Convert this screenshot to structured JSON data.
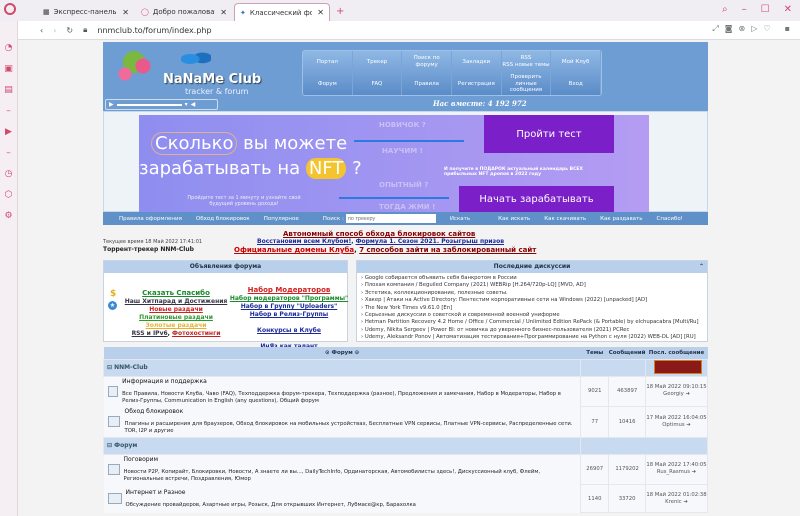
{
  "browser": {
    "tabs": [
      {
        "label": "Экспресс-панель"
      },
      {
        "label": "Добро пожаловать в Opera"
      },
      {
        "label": "Классический форум-трекер"
      }
    ],
    "url": "nnmclub.to/forum/index.php"
  },
  "header": {
    "logo": "NaNaMe Club",
    "logo_sub": "tracker & forum",
    "together": "Нас вместе: 4 192 972",
    "menu": [
      "Портал",
      "Трекер",
      "Поиск по форуму",
      "Закладки",
      "RSS\nRSS новые темы",
      "Мой Клуб",
      "Форум",
      "FAQ",
      "Правила",
      "Регистрация",
      "Проверить личные сообщения",
      "Вход"
    ]
  },
  "banner": {
    "line1a": "Сколько",
    "line1b": " вы можете",
    "line2a": "зарабатывать на ",
    "nft": "NFT",
    "line2b": " ?",
    "sub": "Пройдите тест за 1 минуту и узнайте свой будущий уровень дохода!",
    "q1": "НОВИЧОК ?",
    "q2": "НАУЧИМ !",
    "q3": "ОПЫТНЫЙ ?",
    "q4": "ТОГДА ЖМИ !",
    "btn1": "Пройти тест",
    "btn2": "Начать зарабатывать",
    "gift": "И получите в ПОДАРОК актуальный календарь ВСЕХ прибыльных NFT дропов в 2022 году"
  },
  "nav": {
    "items": [
      "Правила оформления",
      "Обход блокировок",
      "Популярное"
    ],
    "search_label": "Поиск :",
    "search_placeholder": "по трекеру",
    "search_btn": "Искать",
    "links": [
      "Как искать",
      "Как скачивать",
      "Как раздавать",
      "Спасибо!"
    ]
  },
  "notice": {
    "n1": "Автономный способ обхода блокировок сайтов",
    "n2a": "Восстановим всем Клубом!",
    "n2b": "Формула 1. Сезон 2021. Розыгрыш призов",
    "n3a": "Официальные домены Клуба",
    "n3b": "7 способов зайти на заблокированный сайт",
    "time": "Текущее время 18 Май 2022 17:41:01",
    "tracker": "Торрент-трекер NNM-Club"
  },
  "announce": {
    "title": "Объявления форума",
    "left": [
      "Сказать Спасибо",
      "Наш Хитпарад и Достижения",
      "Новые раздачи",
      "Платиновые раздачи",
      "Золотые раздачи",
      "RSS и IPv6",
      "Фотохостинги"
    ],
    "right": [
      "Набор Модераторов",
      "Набор модераторов \"Программы\"",
      "Набор в Группу \"Uploaders\"",
      "Набор в Релиз-Группы",
      "Конкурсы в Клубе",
      "ИнЯз как талант"
    ]
  },
  "discussions": {
    "title": "Последние дискуссии",
    "items": [
      "Google собирается объявить себя банкротом в России",
      "Плохая компания / Beguiled Company (2021) WEBRip [H.264/720p-LQ] [MVO, AD]",
      "Эстетика, коллекционирование, полезные советы.",
      "Хакер | Атаки на Active Directory: Пентестим корпоративные сети на Windows (2022) [unpacked] [AD]",
      "The New York Times v9.61.0 [En]",
      "Серьезные дискуссии о советской и современной военной униформе",
      "Hetman Partition Recovery 4.2 Home / Office / Commercial / Unlimited Edition RePack (& Portable) by elchupacabra [Multi/Ru]",
      "Udemy, Nikita Sergeev | Power BI: от новичка до уверенного бизнес-пользователя (2021) PCRec",
      "Udemy, Aleksandr Ponov | Автоматизация тестирования+Программирование на Python с нуля (2022) WEB-DL [AD] [RU]"
    ]
  },
  "forum": {
    "headers": [
      "Форум",
      "Темы",
      "Сообщений",
      "Посл. сообщение"
    ],
    "categories": [
      {
        "name": "NNM-Club",
        "forums": [
          {
            "title": "Информация и поддержка",
            "subs": "Все Правила, Новости Клуба, Чаво (FAQ), Техподдержка форум-трекера, Техподдержка (разное), Предложения и замечания, Набор в Модераторы, Набор в Релиз-Группы, Communication in English (any questions), Общий форум",
            "topics": "9021",
            "posts": "463897",
            "last_date": "18 Май 2022 09:10:15",
            "last_user": "Georgiy"
          },
          {
            "title": "Обход блокировок",
            "subs": "Плагины и расширения для браузеров, Обход блокировок на мобильных устройствах, Бесплатные VPN сервисы, Платные VPN-сервисы, Распределенные сети. TOR, I2P и другие",
            "topics": "77",
            "posts": "10416",
            "last_date": "17 Май 2022 16:04:05",
            "last_user": "Optimus"
          }
        ]
      },
      {
        "name": "Форум",
        "forums": [
          {
            "title": "Поговорим",
            "subs": "Новости P2P, Копирайт, Блокировки, Новости, А знаете ли вы..., DailyTechInfo, Ординаторская, Автомобилисты здесь!, Дискуссионный клуб, Флейм, Региональные встречи, Поздравления, Юмор",
            "topics": "26907",
            "posts": "1179202",
            "last_date": "18 Май 2022 17:40:05",
            "last_user": "Rus_Rasmus"
          },
          {
            "title": "Интернет и Разное",
            "subs": "Обсуждение провайдеров, Азартные игры, Розыск, Для открывших Интернет, Лубмасе@кр, Барахолка",
            "topics": "1140",
            "posts": "33720",
            "last_date": "18 Май 2022 01:02:38",
            "last_user": "Krenic"
          }
        ]
      }
    ]
  },
  "colors": {
    "header": "#6d9dd2",
    "nav": "#5f90c8",
    "accent": "#d04a6e"
  }
}
